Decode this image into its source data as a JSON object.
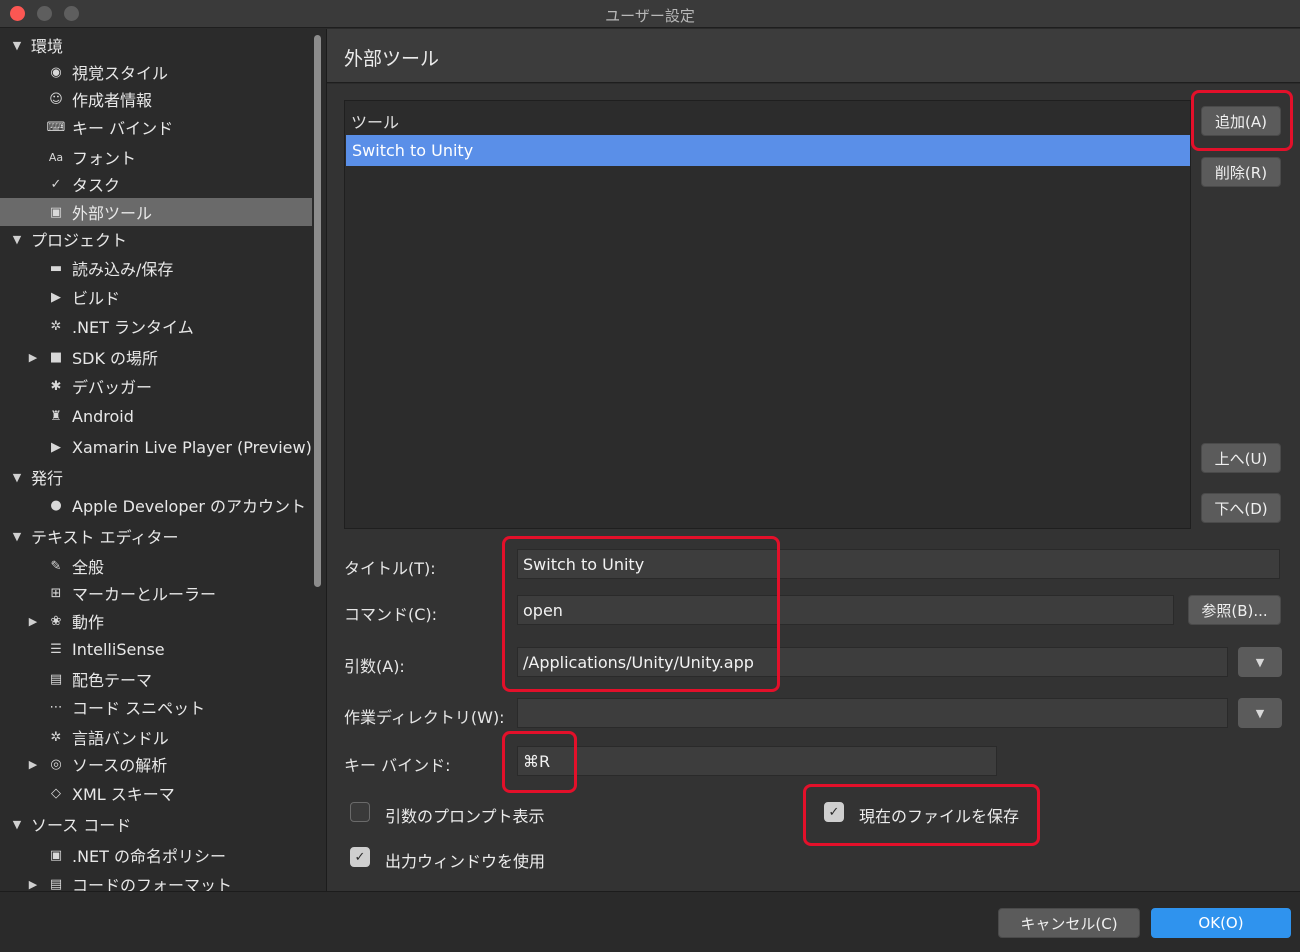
{
  "window": {
    "title": "ユーザー設定"
  },
  "sidebar": {
    "items": [
      {
        "label": "環境",
        "type": "section"
      },
      {
        "label": "視覚スタイル",
        "icon": "eye-icon"
      },
      {
        "label": "作成者情報",
        "icon": "smiley-icon"
      },
      {
        "label": "キー バインド",
        "icon": "keyboard-icon"
      },
      {
        "label": "フォント",
        "icon": "font-icon"
      },
      {
        "label": "タスク",
        "icon": "checkmark-icon"
      },
      {
        "label": "外部ツール",
        "icon": "terminal-icon",
        "selected": true
      },
      {
        "label": "プロジェクト",
        "type": "section"
      },
      {
        "label": "読み込み/保存",
        "icon": "drive-icon"
      },
      {
        "label": "ビルド",
        "icon": "build-icon"
      },
      {
        "label": ".NET ランタイム",
        "icon": "gear-icon"
      },
      {
        "label": "SDK の場所",
        "icon": "folder-icon"
      },
      {
        "label": "デバッガー",
        "icon": "bug-icon"
      },
      {
        "label": "Android",
        "icon": "android-icon"
      },
      {
        "label": "Xamarin Live Player (Preview)",
        "icon": "play-icon"
      },
      {
        "label": "発行",
        "type": "section"
      },
      {
        "label": "Apple Developer のアカウント",
        "icon": "apple-icon"
      },
      {
        "label": "テキスト エディター",
        "type": "section"
      },
      {
        "label": "全般",
        "icon": "pencil-icon"
      },
      {
        "label": "マーカーとルーラー",
        "icon": "grid-icon"
      },
      {
        "label": "動作",
        "icon": "brain-icon"
      },
      {
        "label": "IntelliSense",
        "icon": "list-icon"
      },
      {
        "label": "配色テーマ",
        "icon": "palette-icon"
      },
      {
        "label": "コード スニペット",
        "icon": "snippet-icon"
      },
      {
        "label": "言語バンドル",
        "icon": "gear-icon"
      },
      {
        "label": "ソースの解析",
        "icon": "target-icon"
      },
      {
        "label": "XML スキーマ",
        "icon": "xml-icon"
      },
      {
        "label": "ソース コード",
        "type": "section"
      },
      {
        "label": ".NET の命名ポリシー",
        "icon": "naming-icon"
      },
      {
        "label": "コードのフォーマット",
        "icon": "format-icon"
      }
    ]
  },
  "panel": {
    "title": "外部ツール",
    "tools_header": "ツール",
    "tools": [
      "Switch to Unity"
    ],
    "buttons": {
      "add": "追加(A)",
      "remove": "削除(R)",
      "up": "上へ(U)",
      "down": "下へ(D)",
      "browse": "参照(B)..."
    },
    "fields": {
      "title_label": "タイトル(T):",
      "title_value": "Switch to Unity",
      "command_label": "コマンド(C):",
      "command_value": "open",
      "args_label": "引数(A):",
      "args_value": "/Applications/Unity/Unity.app",
      "workdir_label": "作業ディレクトリ(W):",
      "workdir_value": "",
      "keybind_label": "キー バインド:",
      "keybind_value": "⌘R"
    },
    "checkboxes": {
      "prompt_args": {
        "label": "引数のプロンプト表示",
        "checked": false
      },
      "save_file": {
        "label": "現在のファイルを保存",
        "checked": true
      },
      "use_output": {
        "label": "出力ウィンドウを使用",
        "checked": true
      }
    }
  },
  "footer": {
    "cancel": "キャンセル(C)",
    "ok": "OK(O)"
  },
  "colors": {
    "selection": "#5a8fe8",
    "primary_button": "#2f93ee",
    "highlight": "#e3102a"
  }
}
